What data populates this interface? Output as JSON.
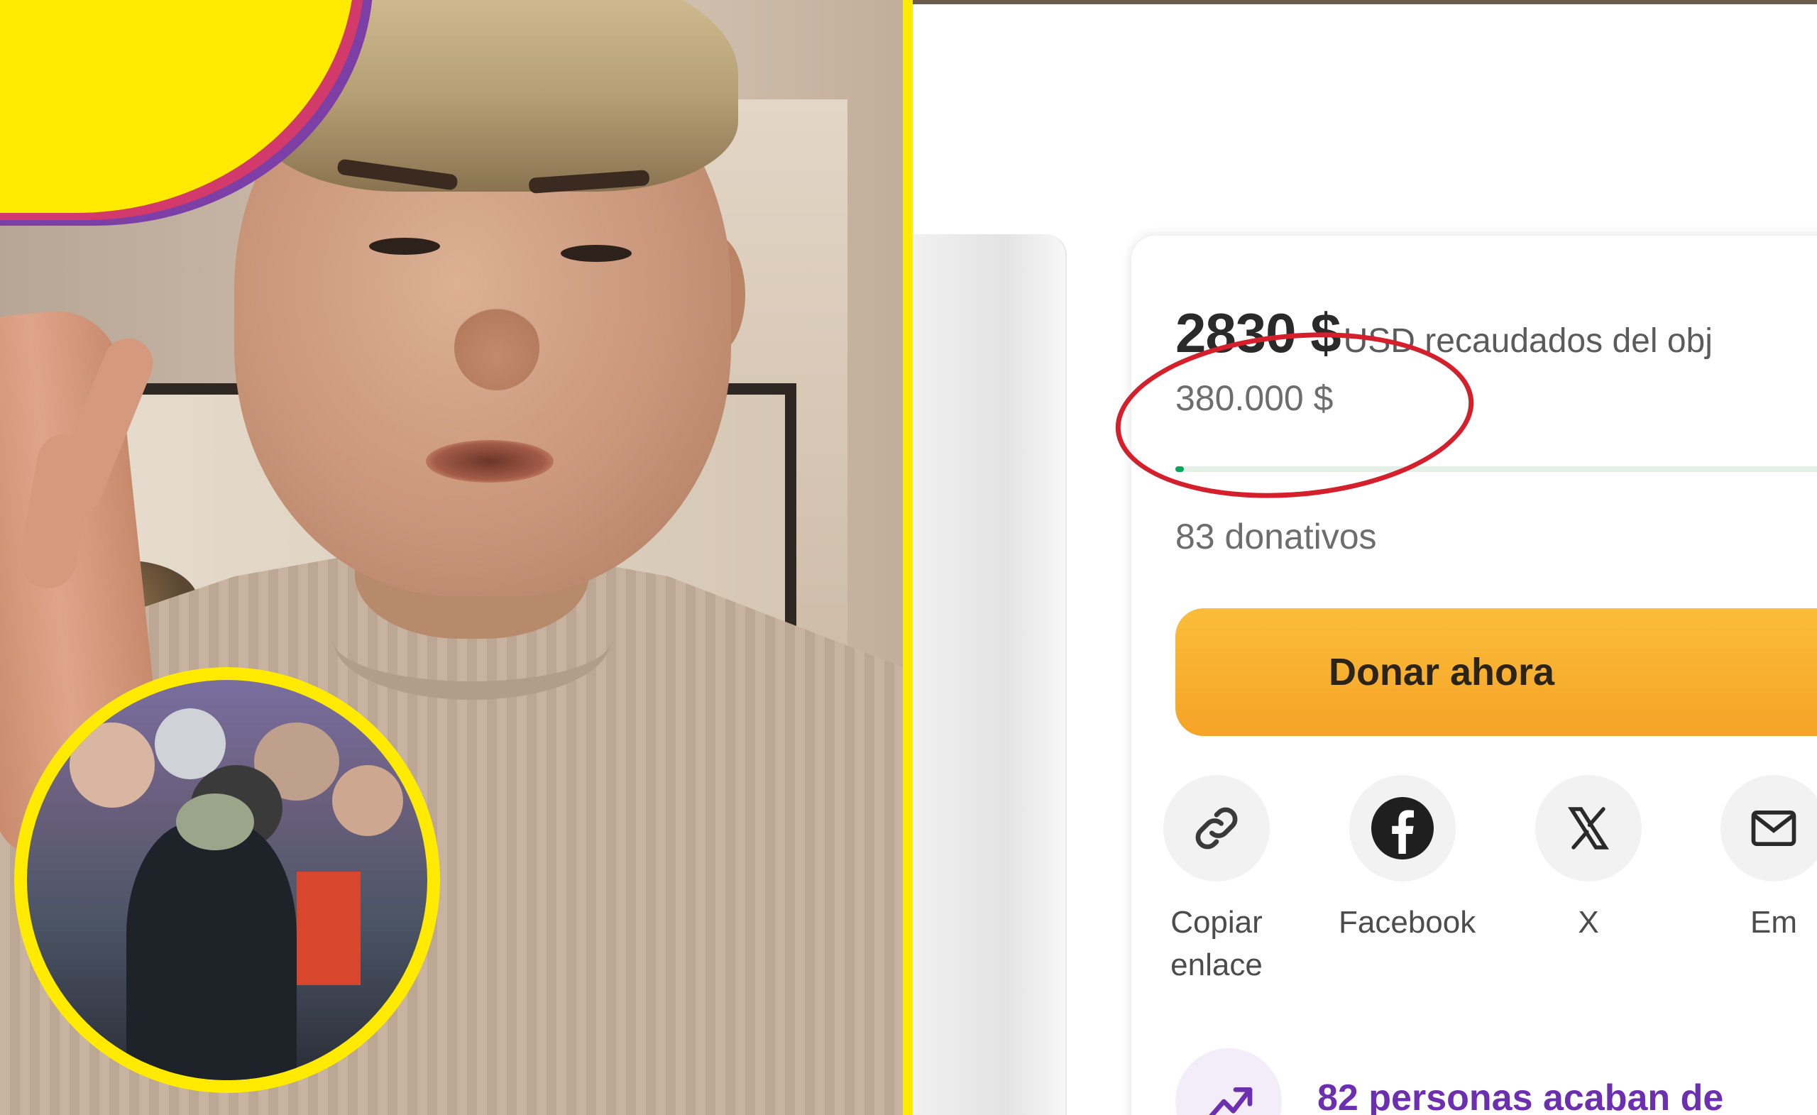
{
  "fundraiser": {
    "raised_amount": "2830 $",
    "raised_text": "USD recaudados del obj",
    "goal_amount": "380.000 $",
    "progress_fraction": 0.0074,
    "donations_count": "83 donativos",
    "donate_button_label": "Donar ahora",
    "share_options": [
      {
        "label_line1": "Copiar",
        "label_line2": "enlace",
        "icon": "link-icon"
      },
      {
        "label_line1": "Facebook",
        "label_line2": "",
        "icon": "facebook-icon"
      },
      {
        "label_line1": "X",
        "label_line2": "",
        "icon": "x-icon"
      },
      {
        "label_line1": "Em",
        "label_line2": "",
        "icon": "email-icon"
      }
    ],
    "trending_text": "82 personas acaban de",
    "trending_icon": "trending-up-icon"
  },
  "colors": {
    "accent_yellow": "#ffea00",
    "donate_button": "#f9b233",
    "progress_green": "#02a95c",
    "trending_purple": "#6c2fb0",
    "annotation_red": "#d4202c"
  }
}
